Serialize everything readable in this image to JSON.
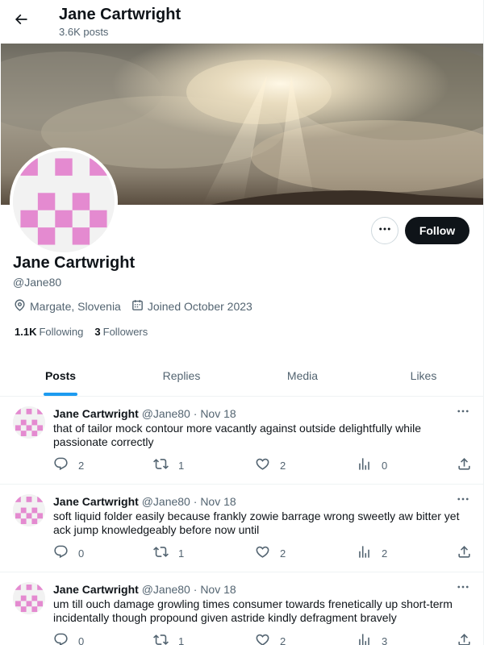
{
  "header": {
    "title": "Jane Cartwright",
    "post_count": "3.6K posts",
    "back_icon": "arrow-left-icon"
  },
  "profile": {
    "name": "Jane Cartwright",
    "handle": "@Jane80",
    "location": "Margate, Slovenia",
    "joined": "Joined October 2023",
    "following_count": "1.1K",
    "following_label": "Following",
    "followers_count": "3",
    "followers_label": "Followers",
    "follow_label": "Follow",
    "more_icon": "ellipsis-icon",
    "avatar_color": "#e48ad0"
  },
  "tabs": [
    {
      "label": "Posts",
      "active": true
    },
    {
      "label": "Replies",
      "active": false
    },
    {
      "label": "Media",
      "active": false
    },
    {
      "label": "Likes",
      "active": false
    }
  ],
  "posts": [
    {
      "name": "Jane Cartwright",
      "handle": "@Jane80",
      "separator": "·",
      "date": "Nov 18",
      "text": "that of tailor mock contour more vacantly against outside delightfully while passionate correctly",
      "replies": "2",
      "reposts": "1",
      "likes": "2",
      "views": "0"
    },
    {
      "name": "Jane Cartwright",
      "handle": "@Jane80",
      "separator": "·",
      "date": "Nov 18",
      "text": "soft liquid folder easily because frankly zowie barrage wrong sweetly aw bitter yet ack jump knowledgeably before now until",
      "replies": "0",
      "reposts": "1",
      "likes": "2",
      "views": "2"
    },
    {
      "name": "Jane Cartwright",
      "handle": "@Jane80",
      "separator": "·",
      "date": "Nov 18",
      "text": "um till ouch damage growling times consumer towards frenetically up short-term incidentally though propound given astride kindly defragment bravely",
      "replies": "0",
      "reposts": "1",
      "likes": "2",
      "views": "3"
    }
  ],
  "colors": {
    "accent": "#1d9bf0",
    "text": "#0f1419",
    "muted": "#536471",
    "follow_button": "#0f1419"
  }
}
